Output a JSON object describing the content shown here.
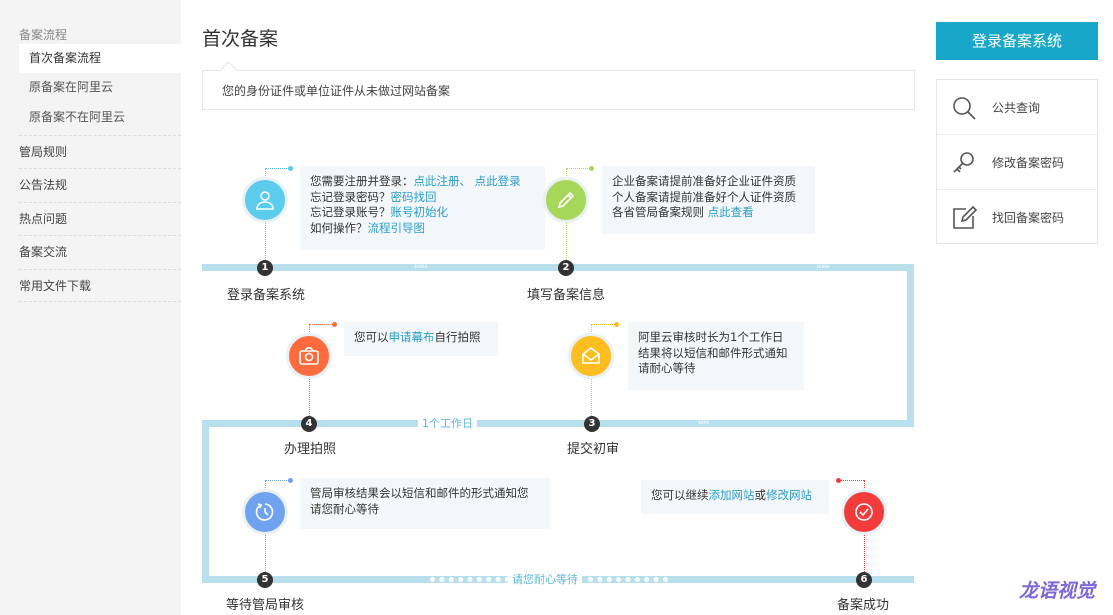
{
  "sidebar": {
    "group": "备案流程",
    "subs": [
      "首次备案流程",
      "原备案在阿里云",
      "原备案不在阿里云"
    ],
    "items": [
      "管局规则",
      "公告法规",
      "热点问题",
      "备案交流",
      "常用文件下载"
    ]
  },
  "main": {
    "title": "首次备案",
    "note": "您的身份证件或单位证件从未做过网站备案",
    "wait1": "1个工作日",
    "wait2": "请您耐心等待",
    "steps": [
      {
        "num": "1",
        "label": "登录备案系统"
      },
      {
        "num": "2",
        "label": "填写备案信息"
      },
      {
        "num": "3",
        "label": "提交初审"
      },
      {
        "num": "4",
        "label": "办理拍照"
      },
      {
        "num": "5",
        "label": "等待管局审核"
      },
      {
        "num": "6",
        "label": "备案成功"
      }
    ],
    "info1": {
      "l1_pre": "您需要注册并登录：",
      "l1_link1": "点此注册、",
      "l1_link2": "点此登录",
      "l2_pre": "忘记登录密码？",
      "l2_link": "密码找回",
      "l3_pre": "忘记登录账号？",
      "l3_link": "账号初始化",
      "l4_pre": "如何操作？",
      "l4_link": "流程引导图"
    },
    "info2": {
      "l1": "企业备案请提前准备好企业证件资质",
      "l2": "个人备案请提前准备好个人证件资质",
      "l3_pre": "各省管局备案规则 ",
      "l3_link": "点此查看"
    },
    "info3": {
      "l1": "阿里云审核时长为1个工作日",
      "l2": "结果将以短信和邮件形式通知",
      "l3": "请耐心等待"
    },
    "info4": {
      "pre": "您可以",
      "link": "申请幕布",
      "post": "自行拍照"
    },
    "info5": {
      "l1": "管局审核结果会以短信和邮件的形式通知您",
      "l2": "请您耐心等待"
    },
    "info6": {
      "pre": "您可以继续",
      "link1": "添加网站",
      "mid": "或",
      "link2": "修改网站"
    }
  },
  "right": {
    "login_button": "登录备案系统",
    "links": [
      {
        "icon": "search-icon",
        "label": "公共查询"
      },
      {
        "icon": "key-icon",
        "label": "修改备案密码"
      },
      {
        "icon": "edit-icon",
        "label": "找回备案密码"
      }
    ]
  },
  "watermark": "龙语视觉",
  "colors": {
    "accent": "#19a7c9",
    "track": "#b7e0ec",
    "step1": "#5bcbee",
    "step2": "#a6d65a",
    "step3": "#ffbe1f",
    "step4": "#ff6b3d",
    "step5": "#6fa3f0",
    "step6": "#f23c3c"
  }
}
